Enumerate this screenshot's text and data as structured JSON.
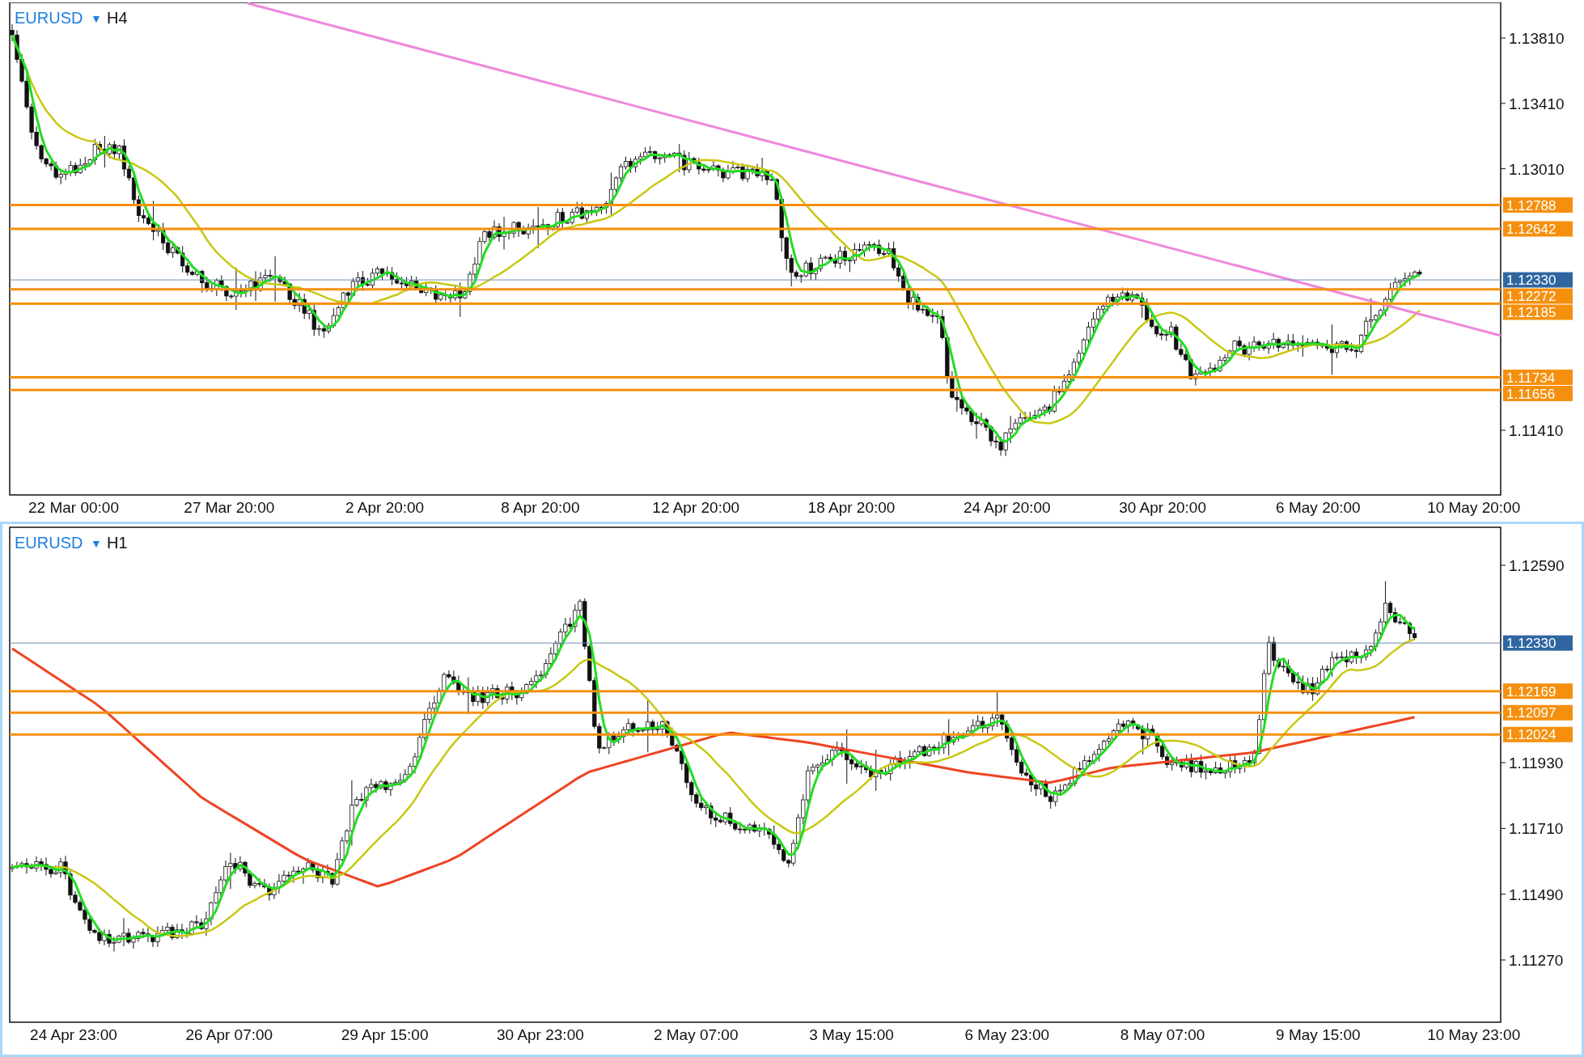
{
  "panels": [
    {
      "symbol": "EURUSD",
      "caret": "▼",
      "timeframe": "H4",
      "selected": false,
      "trendline": true,
      "long_ma": false,
      "price_ticks": [
        "1.13810",
        "1.13410",
        "1.13010",
        "1.11410"
      ],
      "current_price": "1.12330",
      "levels": [
        "1.12788",
        "1.12642",
        "1.12272",
        "1.12185",
        "1.11734",
        "1.11656"
      ],
      "time_labels": [
        "22 Mar 00:00",
        "27 Mar 20:00",
        "2 Apr 20:00",
        "8 Apr 20:00",
        "12 Apr 20:00",
        "18 Apr 20:00",
        "24 Apr 20:00",
        "30 Apr 20:00",
        "6 May 20:00",
        "10 May 20:00"
      ]
    },
    {
      "symbol": "EURUSD",
      "caret": "▼",
      "timeframe": "H1",
      "selected": true,
      "trendline": false,
      "long_ma": true,
      "price_ticks": [
        "1.12590",
        "1.11930",
        "1.11710",
        "1.11490",
        "1.11270"
      ],
      "current_price": "1.12330",
      "levels": [
        "1.12169",
        "1.12097",
        "1.12024"
      ],
      "time_labels": [
        "24 Apr 23:00",
        "26 Apr 07:00",
        "29 Apr 15:00",
        "30 Apr 23:00",
        "2 May 07:00",
        "3 May 15:00",
        "6 May 23:00",
        "8 May 07:00",
        "9 May 15:00",
        "10 May 23:00"
      ]
    }
  ]
}
